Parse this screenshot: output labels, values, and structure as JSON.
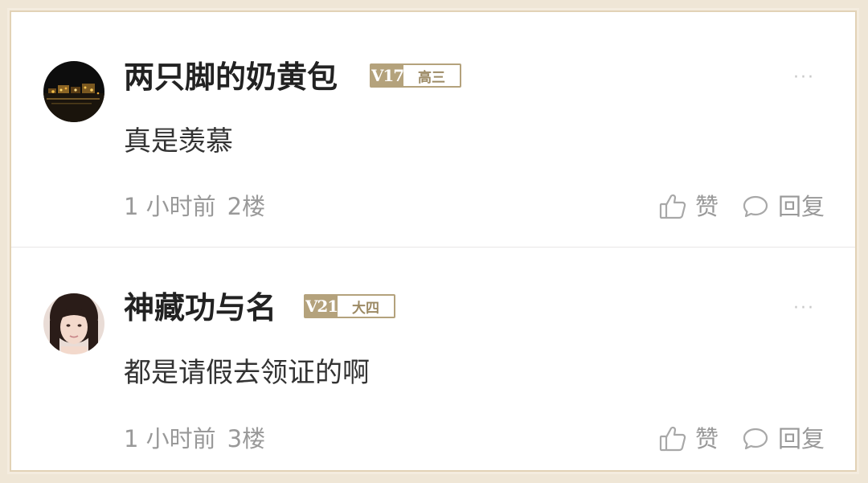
{
  "comments": [
    {
      "username": "两只脚的奶黄包",
      "level": "V17",
      "grade": "高三",
      "text": "真是羡慕",
      "time": "1 小时前",
      "floor": "2楼",
      "like_label": "赞",
      "reply_label": "回复",
      "more": "···"
    },
    {
      "username": "神藏功与名",
      "level": "V21",
      "grade": "大四",
      "text": "都是请假去领证的啊",
      "time": "1 小时前",
      "floor": "3楼",
      "like_label": "赞",
      "reply_label": "回复",
      "more": "···"
    }
  ],
  "colors": {
    "badge": "#b4a27c",
    "username": "#222222",
    "meta": "#999999",
    "frame": "#e2d2b6"
  }
}
